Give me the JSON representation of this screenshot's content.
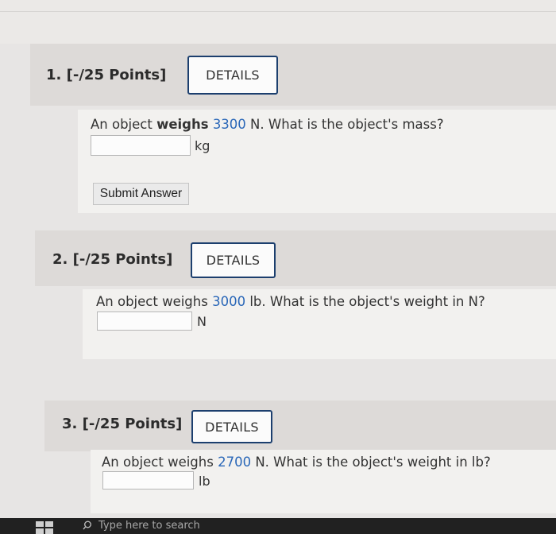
{
  "questions": [
    {
      "number": "1.",
      "points": "[-/25 Points]",
      "details_label": "DETAILS",
      "text_before": "An object ",
      "text_bold": "weighs",
      "text_space": " ",
      "value": "3300",
      "text_after": " N. What is the object's mass?",
      "answer_value": "",
      "unit": "kg",
      "submit_label": "Submit Answer"
    },
    {
      "number": "2.",
      "points": "[-/25 Points]",
      "details_label": "DETAILS",
      "text_before": "An object weighs ",
      "value": "3000",
      "text_after": " lb. What is the object's weight in N?",
      "answer_value": "",
      "unit": "N"
    },
    {
      "number": "3.",
      "points": "[-/25 Points]",
      "details_label": "DETAILS",
      "text_before": "An object weighs ",
      "value": "2700",
      "text_after": " N. What is the object's weight in lb?",
      "answer_value": "",
      "unit": "lb"
    }
  ],
  "taskbar": {
    "search_placeholder": "Type here to search"
  }
}
